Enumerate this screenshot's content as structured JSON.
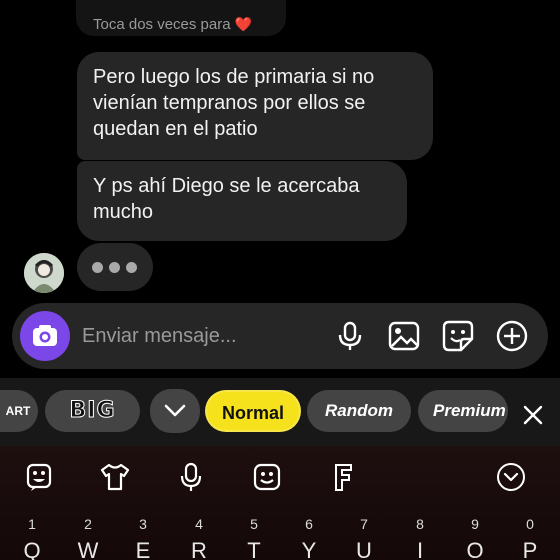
{
  "chat": {
    "hint_text": "Toca dos veces para",
    "hint_heart": "❤️",
    "messages": [
      {
        "text": "Pero luego los de primaria si no vienían tempranos por ellos se quedan en el patio"
      },
      {
        "text": "Y ps ahí Diego se le acercaba mucho"
      }
    ]
  },
  "composer": {
    "placeholder": "Enviar mensaje..."
  },
  "suggestion_strip": {
    "chips": {
      "art": "ART",
      "big": "BIG",
      "normal": "Normal",
      "random": "Random",
      "premium": "Premium"
    }
  },
  "keyboard": {
    "numbers": [
      "1",
      "2",
      "3",
      "4",
      "5",
      "6",
      "7",
      "8",
      "9",
      "0"
    ],
    "letters": [
      "Q",
      "W",
      "E",
      "R",
      "T",
      "Y",
      "U",
      "I",
      "O",
      "P"
    ]
  },
  "colors": {
    "accent_purple": "#7b47e9",
    "chip_selected": "#f6e21c",
    "bubble_bg": "#262626",
    "heart": "#e3263c"
  }
}
